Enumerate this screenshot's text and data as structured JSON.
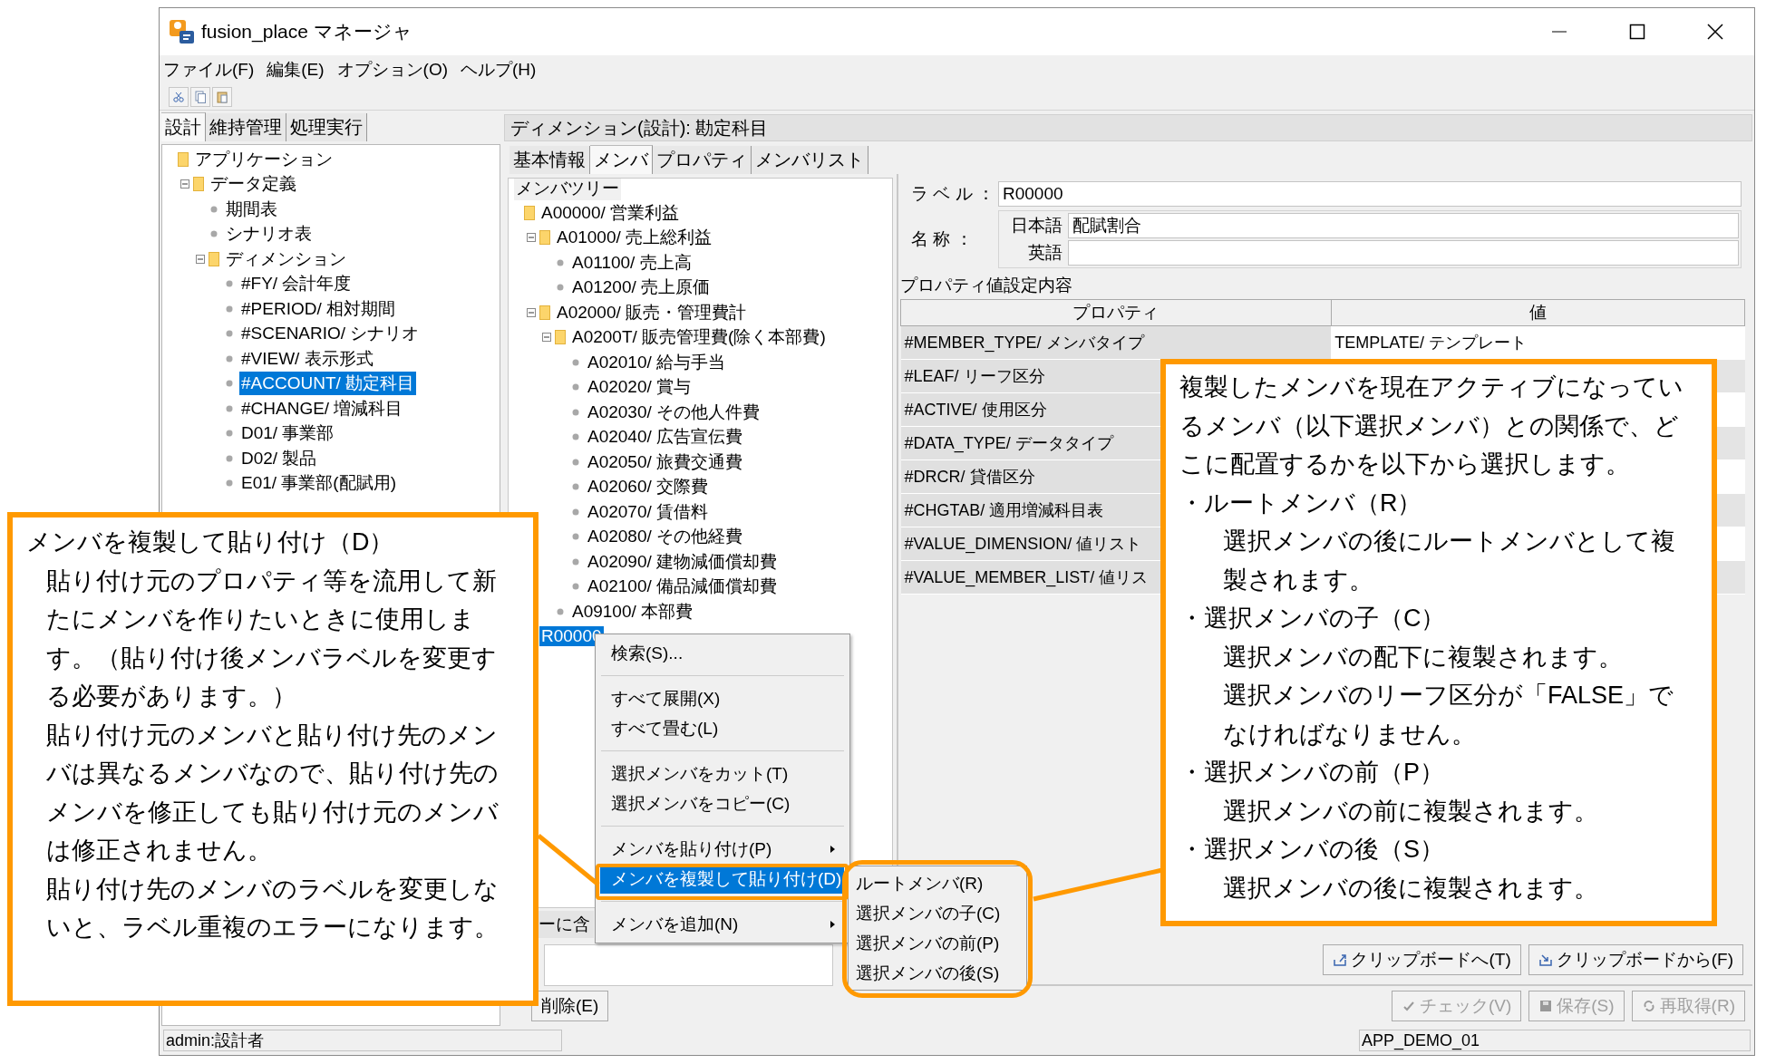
{
  "window": {
    "title": "fusion_place マネージャ"
  },
  "menu_bar": [
    "ファイル(F)",
    "編集(E)",
    "オプション(O)",
    "ヘルプ(H)"
  ],
  "left_tabs": [
    {
      "label": "設計",
      "selected": true
    },
    {
      "label": "維持管理",
      "selected": false
    },
    {
      "label": "処理実行",
      "selected": false
    }
  ],
  "left_tree": [
    {
      "label": "アプリケーション",
      "kind": "folder",
      "selected": false,
      "children": [
        {
          "label": "データ定義",
          "kind": "folder",
          "selected": false,
          "expanded": true,
          "children": [
            {
              "label": "期間表",
              "kind": "leaf",
              "selected": false
            },
            {
              "label": "シナリオ表",
              "kind": "leaf",
              "selected": false
            },
            {
              "label": "ディメンション",
              "kind": "folder",
              "selected": false,
              "expanded": true,
              "children": [
                {
                  "label": "#FY/ 会計年度",
                  "kind": "leaf",
                  "selected": false
                },
                {
                  "label": "#PERIOD/ 相対期間",
                  "kind": "leaf",
                  "selected": false
                },
                {
                  "label": "#SCENARIO/ シナリオ",
                  "kind": "leaf",
                  "selected": false
                },
                {
                  "label": "#VIEW/ 表示形式",
                  "kind": "leaf",
                  "selected": false
                },
                {
                  "label": "#ACCOUNT/ 勘定科目",
                  "kind": "leaf",
                  "selected": true
                },
                {
                  "label": "#CHANGE/ 増減科目",
                  "kind": "leaf",
                  "selected": false
                },
                {
                  "label": "D01/ 事業部",
                  "kind": "leaf",
                  "selected": false
                },
                {
                  "label": "D02/ 製品",
                  "kind": "leaf",
                  "selected": false
                },
                {
                  "label": "E01/ 事業部(配賦用)",
                  "kind": "leaf",
                  "selected": false
                }
              ]
            }
          ]
        }
      ]
    }
  ],
  "right_header": "ディメンション(設計): 勘定科目",
  "right_tabs": [
    {
      "label": "基本情報",
      "selected": false
    },
    {
      "label": "メンバ",
      "selected": true
    },
    {
      "label": "プロパティ",
      "selected": false
    },
    {
      "label": "メンバリスト",
      "selected": false
    }
  ],
  "member_tree": {
    "title": "メンバツリー",
    "items": [
      {
        "label": "A00000/ 営業利益",
        "kind": "folder",
        "selected": false,
        "children": [
          {
            "label": "A01000/ 売上総利益",
            "kind": "folder",
            "selected": false,
            "expanded": true,
            "children": [
              {
                "label": "A01100/ 売上高",
                "kind": "leaf",
                "selected": false
              },
              {
                "label": "A01200/ 売上原価",
                "kind": "leaf",
                "selected": false
              }
            ]
          },
          {
            "label": "A02000/ 販売・管理費計",
            "kind": "folder",
            "selected": false,
            "expanded": true,
            "children": [
              {
                "label": "A0200T/ 販売管理費(除く本部費)",
                "kind": "folder",
                "selected": false,
                "expanded": true,
                "children": [
                  {
                    "label": "A02010/ 給与手当",
                    "kind": "leaf",
                    "selected": false
                  },
                  {
                    "label": "A02020/ 賞与",
                    "kind": "leaf",
                    "selected": false
                  },
                  {
                    "label": "A02030/ その他人件費",
                    "kind": "leaf",
                    "selected": false
                  },
                  {
                    "label": "A02040/ 広告宣伝費",
                    "kind": "leaf",
                    "selected": false
                  },
                  {
                    "label": "A02050/ 旅費交通費",
                    "kind": "leaf",
                    "selected": false
                  },
                  {
                    "label": "A02060/ 交際費",
                    "kind": "leaf",
                    "selected": false
                  },
                  {
                    "label": "A02070/ 賃借料",
                    "kind": "leaf",
                    "selected": false
                  },
                  {
                    "label": "A02080/ その他経費",
                    "kind": "leaf",
                    "selected": false
                  },
                  {
                    "label": "A02090/ 建物減価償却費",
                    "kind": "leaf",
                    "selected": false
                  },
                  {
                    "label": "A02100/ 備品減価償却費",
                    "kind": "leaf",
                    "selected": false
                  }
                ]
              },
              {
                "label": "A09100/ 本部費",
                "kind": "leaf",
                "selected": false
              }
            ]
          }
        ]
      },
      {
        "label": "R00000",
        "kind": "plain",
        "selected": true
      }
    ],
    "option_label": "ーに含"
  },
  "detail": {
    "label_caption": "ラ ベ ル ：",
    "label_value": "R00000",
    "name_caption": "名 称 ：",
    "ja_caption": "日本語",
    "ja_value": "配賦割合",
    "en_caption": "英語"
  },
  "properties": {
    "title": "プロパティ値設定内容",
    "columns": [
      "プロパティ",
      "値"
    ],
    "rows": [
      {
        "property": "#MEMBER_TYPE/ メンバタイプ",
        "value": "TEMPLATE/ テンプレート"
      },
      {
        "property": "#LEAF/ リーフ区分"
      },
      {
        "property": "#ACTIVE/ 使用区分"
      },
      {
        "property": "#DATA_TYPE/ データタイプ"
      },
      {
        "property": "#DRCR/ 貸借区分"
      },
      {
        "property": "#CHGTAB/ 適用増減科目表"
      },
      {
        "property": "#VALUE_DIMENSION/ 値リスト"
      },
      {
        "property": "#VALUE_MEMBER_LIST/ 値リス"
      }
    ]
  },
  "clipboard_buttons": [
    {
      "label": "クリップボードへ(T)",
      "kind": "export"
    },
    {
      "label": "クリップボードから(F)",
      "kind": "import"
    }
  ],
  "delete_button": "削除(E)",
  "action_buttons": [
    {
      "label": "チェック(V)",
      "kind": "check",
      "disabled": true
    },
    {
      "label": "保存(S)",
      "kind": "save",
      "disabled": true
    },
    {
      "label": "再取得(R)",
      "kind": "reload",
      "disabled": true
    }
  ],
  "status_bar": [
    "admin:設計者",
    "APP_DEMO_01"
  ],
  "context_menu": {
    "groups": [
      [
        {
          "label": "検索(S)...",
          "submenu": false,
          "selected": false
        }
      ],
      [
        {
          "label": "すべて展開(X)",
          "submenu": false,
          "selected": false
        },
        {
          "label": "すべて畳む(L)",
          "submenu": false,
          "selected": false
        }
      ],
      [
        {
          "label": "選択メンバをカット(T)",
          "submenu": false,
          "selected": false
        },
        {
          "label": "選択メンバをコピー(C)",
          "submenu": false,
          "selected": false
        }
      ],
      [
        {
          "label": "メンバを貼り付け(P)",
          "submenu": true,
          "selected": false
        },
        {
          "label": "メンバを複製して貼り付け(D)",
          "submenu": true,
          "selected": true
        }
      ],
      [
        {
          "label": "メンバを追加(N)",
          "submenu": true,
          "selected": false
        }
      ]
    ],
    "submenu": [
      "ルートメンバ(R)",
      "選択メンバの子(C)",
      "選択メンバの前(P)",
      "選択メンバの後(S)"
    ]
  },
  "callouts": [
    {
      "paragraphs": [
        {
          "kind": "text",
          "text": "メンバを複製して貼り付け（D）"
        },
        {
          "kind": "indent",
          "text": "貼り付け元のプロパティ等を流用して新たにメンバを作りたいときに使用します。（貼り付け後メンバラベルを変更する必要があります。）"
        },
        {
          "kind": "indent",
          "text": "貼り付け元のメンバと貼り付け先のメンバは異なるメンバなので、貼り付け先のメンバを修正しても貼り付け元のメンバは修正されません。"
        },
        {
          "kind": "indent",
          "text": "貼り付け先のメンバのラベルを変更しないと、ラベル重複のエラーになります。"
        }
      ]
    },
    {
      "paragraphs": [
        {
          "kind": "text",
          "text": "複製したメンバを現在アクティブになっているメンバ（以下選択メンバ）との関係で、どこに配置するかを以下から選択します。"
        },
        {
          "kind": "bullet",
          "text": "・ルートメンバ（R）"
        },
        {
          "kind": "deep",
          "text": "選択メンバの後にルートメンバとして複製されます。"
        },
        {
          "kind": "bullet",
          "text": "・選択メンバの子（C）"
        },
        {
          "kind": "deep",
          "text": "選択メンバの配下に複製されます。"
        },
        {
          "kind": "deep",
          "text": "選択メンバのリーフ区分が「FALSE」でなければなりません。"
        },
        {
          "kind": "bullet",
          "text": "・選択メンバの前（P）"
        },
        {
          "kind": "deep",
          "text": "選択メンバの前に複製されます。"
        },
        {
          "kind": "bullet",
          "text": "・選択メンバの後（S）"
        },
        {
          "kind": "deep",
          "text": "選択メンバの後に複製されます。"
        }
      ]
    }
  ]
}
